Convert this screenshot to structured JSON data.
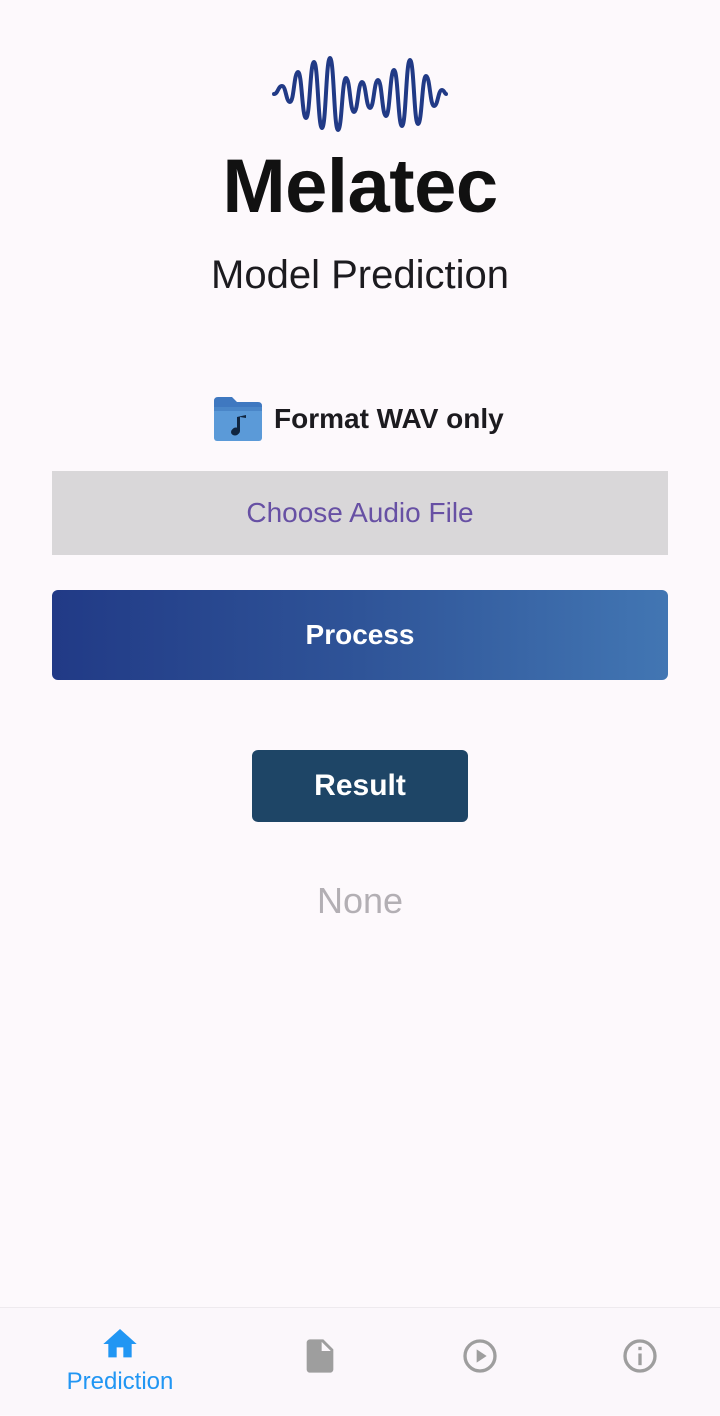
{
  "header": {
    "app_name": "Melatec",
    "subtitle": "Model Prediction",
    "logo_icon": "sound-wave-icon"
  },
  "upload": {
    "format_icon": "audio-folder-icon",
    "format_text": "Format WAV only",
    "choose_label": "Choose Audio File"
  },
  "actions": {
    "process_label": "Process",
    "result_label": "Result"
  },
  "result": {
    "value": "None"
  },
  "bottom_nav": {
    "items": [
      {
        "icon": "home-icon",
        "label": "Prediction",
        "active": true
      },
      {
        "icon": "document-icon",
        "label": "",
        "active": false
      },
      {
        "icon": "play-circle-icon",
        "label": "",
        "active": false
      },
      {
        "icon": "info-icon",
        "label": "",
        "active": false
      }
    ]
  },
  "colors": {
    "background": "#fdf9fc",
    "choose_button_bg": "#d9d7d9",
    "choose_button_text": "#6750a4",
    "process_gradient_start": "#213a86",
    "process_gradient_end": "#4276b3",
    "result_button_bg": "#1e4566",
    "nav_active": "#2196f3",
    "nav_inactive": "#9e9e9e",
    "logo_stroke": "#213a86"
  }
}
